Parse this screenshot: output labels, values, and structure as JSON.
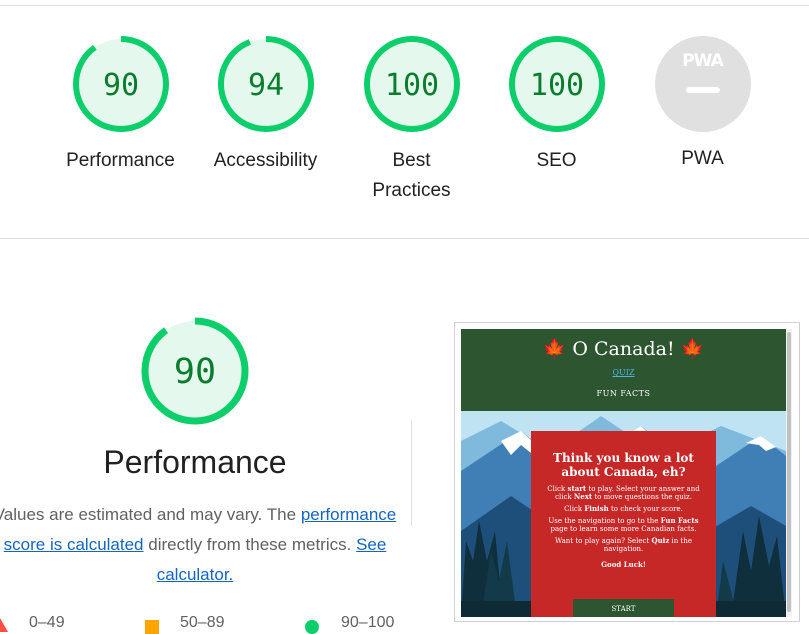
{
  "summary": {
    "gauges": [
      {
        "id": "performance",
        "score": "90",
        "label": "Performance",
        "fraction": 0.9
      },
      {
        "id": "accessibility",
        "score": "94",
        "label": "Accessibility",
        "fraction": 0.94
      },
      {
        "id": "best-practices",
        "score": "100",
        "label": "Best Practices",
        "fraction": 1.0
      },
      {
        "id": "seo",
        "score": "100",
        "label": "SEO",
        "fraction": 1.0
      }
    ],
    "pwa": {
      "badge": "PWA",
      "label": "PWA"
    }
  },
  "performance": {
    "score": "90",
    "fraction": 0.9,
    "title": "Performance",
    "desc_before": "Values are estimated and may vary. The ",
    "desc_link": "performance score is calculated",
    "desc_mid": " directly from these metrics. ",
    "desc_link2": "See calculator."
  },
  "legend": {
    "fail": "0–49",
    "average": "50–89",
    "pass": "90–100"
  },
  "screenshot": {
    "site_title": "O Canada!",
    "maple": "🍁",
    "nav_quiz": "QUIZ",
    "nav_fun": "FUN FACTS",
    "card_heading": "Think you know a lot about Canada, eh?",
    "p1_a": "Click ",
    "p1_b": "start",
    "p1_c": " to play. Select your answer and click ",
    "p1_d": "Next",
    "p1_e": " to move questions the quiz.",
    "p2_a": "Click ",
    "p2_b": "Finish",
    "p2_c": " to check your score.",
    "p3_a": "Use the navigation to go to the ",
    "p3_b": "Fun Facts",
    "p3_c": " page to learn some more Canadian facts.",
    "p4_a": "Want to play again? Select ",
    "p4_b": "Quiz",
    "p4_c": " in the navigation.",
    "luck": "Good Luck!",
    "start": "START"
  },
  "colors": {
    "pass_green": "#0cce6b",
    "pass_fill": "#e5f8ee",
    "pass_text": "#0a7d2c",
    "na_gray": "#e0e0e0",
    "fail_red": "#ff4e42",
    "avg_orange": "#ffa400",
    "link_blue": "#1565c0"
  }
}
